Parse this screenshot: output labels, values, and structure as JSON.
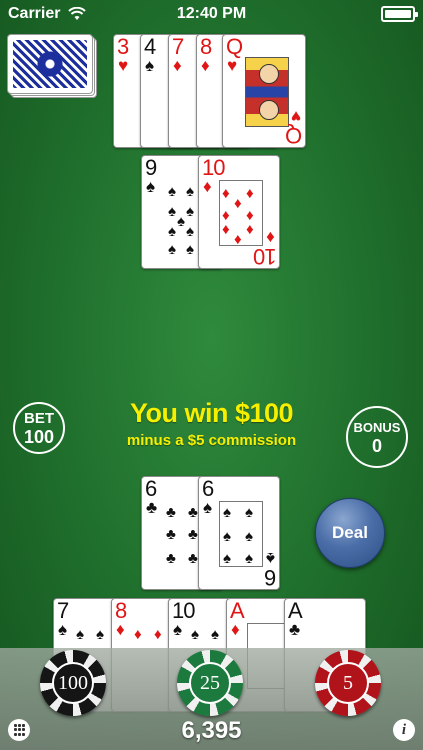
{
  "status_bar": {
    "carrier": "Carrier",
    "time": "12:40 PM"
  },
  "dealer_hand": [
    {
      "rank": "3",
      "suit": "♥",
      "color": "red"
    },
    {
      "rank": "4",
      "suit": "♠",
      "color": "black"
    },
    {
      "rank": "7",
      "suit": "♦",
      "color": "red"
    },
    {
      "rank": "8",
      "suit": "♦",
      "color": "red"
    },
    {
      "rank": "Q",
      "suit": "♥",
      "color": "red"
    }
  ],
  "dealer_second_row": [
    {
      "rank": "9",
      "suit": "♠",
      "color": "black"
    },
    {
      "rank": "10",
      "suit": "♦",
      "color": "red"
    }
  ],
  "message": {
    "win": "You win $100",
    "sub": "minus a $5 commission"
  },
  "bet": {
    "label": "BET",
    "value": "100"
  },
  "bonus": {
    "label": "BONUS",
    "value": "0"
  },
  "player_upper": [
    {
      "rank": "6",
      "suit": "♣",
      "color": "black"
    },
    {
      "rank": "6",
      "suit": "♠",
      "color": "black"
    }
  ],
  "player_lower": [
    {
      "rank": "7",
      "suit": "♠",
      "color": "black"
    },
    {
      "rank": "8",
      "suit": "♦",
      "color": "red"
    },
    {
      "rank": "10",
      "suit": "♠",
      "color": "black"
    },
    {
      "rank": "A",
      "suit": "♦",
      "color": "red"
    },
    {
      "rank": "A",
      "suit": "♣",
      "color": "black"
    }
  ],
  "deal_button": "Deal",
  "chips": [
    {
      "value": "100"
    },
    {
      "value": "25"
    },
    {
      "value": "5"
    }
  ],
  "balance": "6,395",
  "info_glyph": "i"
}
